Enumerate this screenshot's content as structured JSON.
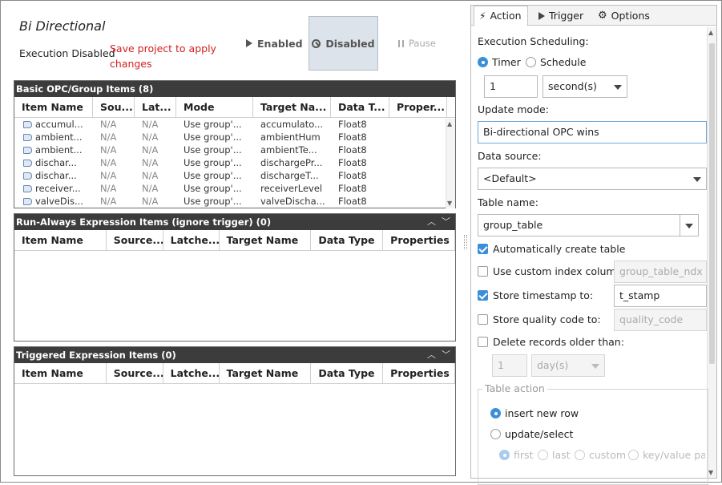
{
  "header": {
    "title": "Bi Directional",
    "status": "Execution Disabled",
    "warning": "Save project to apply changes",
    "enabled_label": "Enabled",
    "disabled_label": "Disabled",
    "pause_label": "Pause"
  },
  "opc_panel": {
    "title": "Basic OPC/Group Items (8)",
    "columns": [
      "Item Name",
      "Sou...",
      "Lat...",
      "Mode",
      "Target Na...",
      "Data T...",
      "Proper..."
    ],
    "rows": [
      [
        "accumul...",
        "N/A",
        "N/A",
        "Use group'...",
        "accumulato...",
        "Float8",
        ""
      ],
      [
        "ambient...",
        "N/A",
        "N/A",
        "Use group'...",
        "ambientHum",
        "Float8",
        ""
      ],
      [
        "ambient...",
        "N/A",
        "N/A",
        "Use group'...",
        "ambientTe...",
        "Float8",
        ""
      ],
      [
        "dischar...",
        "N/A",
        "N/A",
        "Use group'...",
        "dischargePr...",
        "Float8",
        ""
      ],
      [
        "dischar...",
        "N/A",
        "N/A",
        "Use group'...",
        "dischargeT...",
        "Float8",
        ""
      ],
      [
        "receiver...",
        "N/A",
        "N/A",
        "Use group'...",
        "receiverLevel",
        "Float8",
        ""
      ],
      [
        "valveDis...",
        "N/A",
        "N/A",
        "Use group'...",
        "valveDischa...",
        "Float8",
        ""
      ]
    ]
  },
  "run_always_panel": {
    "title": "Run-Always Expression Items (ignore trigger) (0)",
    "columns": [
      "Item Name",
      "Source...",
      "Latche...",
      "Target Name",
      "Data Type",
      "Properties"
    ]
  },
  "triggered_panel": {
    "title": "Triggered Expression Items (0)",
    "columns": [
      "Item Name",
      "Source...",
      "Latche...",
      "Target Name",
      "Data Type",
      "Properties"
    ]
  },
  "right_panel": {
    "tabs": {
      "action": "Action",
      "trigger": "Trigger",
      "options": "Options"
    },
    "execution_scheduling": "Execution Scheduling:",
    "timer": "Timer",
    "schedule": "Schedule",
    "rate_value": "1",
    "rate_unit": "second(s)",
    "update_mode_label": "Update mode:",
    "update_mode_value": "Bi-directional OPC wins",
    "data_source_label": "Data source:",
    "data_source_value": "<Default>",
    "table_name_label": "Table name:",
    "table_name_value": "group_table",
    "auto_create": "Automatically create table",
    "custom_index": "Use custom index column:",
    "custom_index_value": "group_table_ndx",
    "store_timestamp": "Store timestamp to:",
    "timestamp_value": "t_stamp",
    "store_quality": "Store quality code to:",
    "quality_value": "quality_code",
    "delete_older": "Delete records older than:",
    "delete_value": "1",
    "delete_unit": "day(s)",
    "table_action_label": "Table action",
    "insert_new_row": "insert new row",
    "update_select": "update/select",
    "first": "first",
    "last": "last",
    "custom": "custom",
    "key_value": "key/value pair"
  },
  "colors": {
    "accent": "#3a8fd8",
    "panel_header": "#3c3c3c",
    "warning": "#d42020",
    "selected_button": "#dde3ea"
  }
}
